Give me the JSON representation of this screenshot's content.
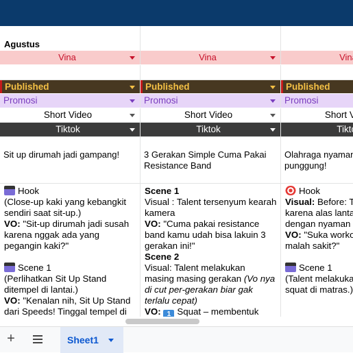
{
  "sheet": {
    "month": "Agustus",
    "columns": [
      {
        "assignee": "Vina",
        "status": "Published",
        "category": "Promosi",
        "format": "Short Video",
        "platform": "Tiktok",
        "title": "Sit up dirumah jadi gampang!",
        "script": [
          {
            "text": "Hook",
            "icon": "clapper"
          },
          {
            "text": "(Close-up kaki yang kebangkit sendiri saat sit-up.)"
          },
          {
            "label": "VO:",
            "text": " \"Sit-up dirumah jadi susah karena nggak ada yang pegangin kaki?\""
          },
          {
            "blank": true
          },
          {
            "text": "Scene 1",
            "icon": "clapper"
          },
          {
            "text": "(Perlihatkan Sit Up Stand ditempel di lantai.)"
          },
          {
            "label": "VO:",
            "text": " \"Kenalan nih, Sit Up Stand dari Speeds! Tinggal tempel di lantai, langsung kokoh.\""
          }
        ]
      },
      {
        "assignee": "Vina",
        "status": "Published",
        "category": "Promosi",
        "format": "Short Video",
        "platform": "Tiktok",
        "title": "3 Gerakan Simple Cuma Pakai Resistance Band",
        "script": [
          {
            "label": "Scene 1",
            "text": ""
          },
          {
            "text": "Visual : Talent tersenyum kearah kamera"
          },
          {
            "label": "VO:",
            "text": " \"Cuma pakai resistance band kamu udah bisa lakuin 3 gerakan ini!\""
          },
          {
            "label": "Scene 2",
            "text": ""
          },
          {
            "text": "Visual: Talent melakukan masing masing gerakan ",
            "italic": "(Vo nya di cut per-gerakan biar gak terlalu cepat)"
          },
          {
            "label": "VO:",
            "text": " Squat – membentuk",
            "icon": "keycap",
            "icon_text": "1"
          }
        ]
      },
      {
        "assignee": "Vina",
        "status": "Published",
        "category": "Promosi",
        "format": "Short Video",
        "platform": "Tiktok",
        "title": "Olahraga nyaman tanpa sakit punggung!",
        "script": [
          {
            "text": "Hook",
            "icon": "target"
          },
          {
            "label": "Visual:",
            "text": " Before: Talent kesakitan karena alas lantai. After: Talent dengan nyaman"
          },
          {
            "label": "VO:",
            "text": " \"Suka workout tapi badan malah sakit?\""
          },
          {
            "blank": true
          },
          {
            "text": "Scene 1",
            "icon": "clapper"
          },
          {
            "text": "(Talent melakukan plank dan squat di matras.)"
          }
        ]
      }
    ]
  },
  "bottom_bar": {
    "add_sheet_label": "+",
    "active_sheet": "Sheet1"
  },
  "colors": {
    "header_bar": "#0b3a6b",
    "assignee_bg": "#f9cbcb",
    "status_bg": "#473821",
    "category_bg": "#e7d5f8",
    "platform_bg": "#3b3b3b",
    "sheet_tab_text": "#0b57d0"
  }
}
